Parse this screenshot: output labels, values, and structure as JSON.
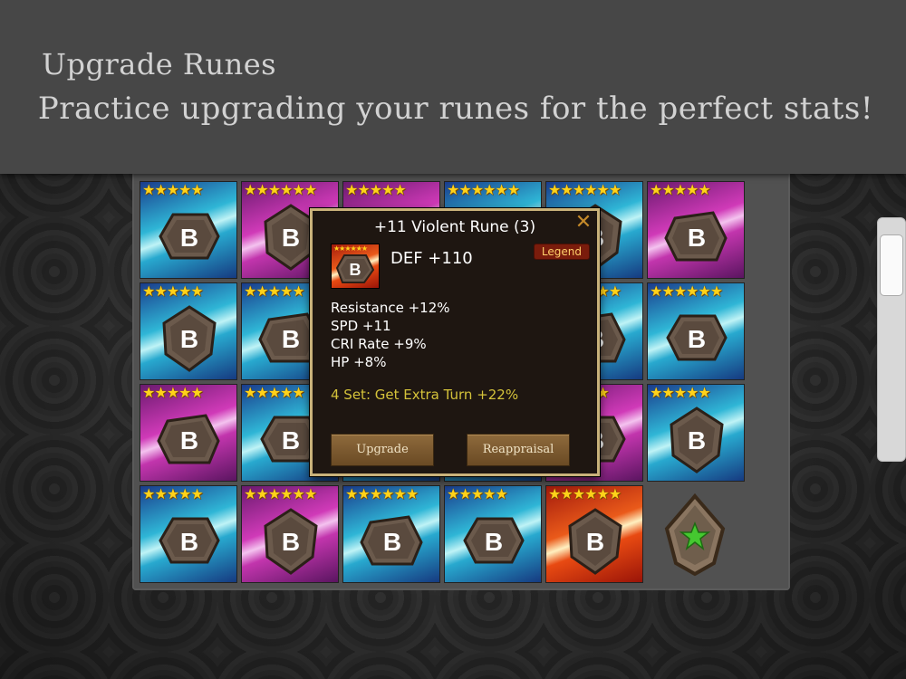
{
  "banner": {
    "title": "Upgrade Runes",
    "subtitle": "Practice upgrading your runes for the perfect stats!"
  },
  "rune_grid": {
    "rows": [
      [
        {
          "color": "blue",
          "stars": "★★★★★"
        },
        {
          "color": "pink",
          "stars": "★★★★★★"
        },
        {
          "color": "pink",
          "stars": "★★★★★"
        },
        {
          "color": "blue",
          "stars": "★★★★★★"
        },
        {
          "color": "blue",
          "stars": "★★★★★★"
        },
        {
          "color": "pink",
          "stars": "★★★★★"
        }
      ],
      [
        {
          "color": "blue",
          "stars": "★★★★★"
        },
        {
          "color": "blue",
          "stars": "★★★★★"
        },
        {
          "color": "blue",
          "stars": "★★★★★"
        },
        {
          "color": "blue",
          "stars": "★★★★★"
        },
        {
          "color": "blue",
          "stars": "★★★★★★"
        },
        {
          "color": "blue",
          "stars": "★★★★★★"
        }
      ],
      [
        {
          "color": "pink",
          "stars": "★★★★★"
        },
        {
          "color": "blue",
          "stars": "★★★★★"
        },
        {
          "color": "blue",
          "stars": "★★★★★"
        },
        {
          "color": "blue",
          "stars": "★★★★★"
        },
        {
          "color": "pink",
          "stars": "★★★★★"
        },
        {
          "color": "blue",
          "stars": "★★★★★"
        }
      ],
      [
        {
          "color": "blue",
          "stars": "★★★★★"
        },
        {
          "color": "pink",
          "stars": "★★★★★★"
        },
        {
          "color": "blue",
          "stars": "★★★★★★"
        },
        {
          "color": "blue",
          "stars": "★★★★★"
        },
        {
          "color": "red",
          "stars": "★★★★★★"
        }
      ]
    ],
    "empty_slot_icon": "star-icon"
  },
  "popup": {
    "title": "+11  Violent Rune (3)",
    "close_icon": "close-icon",
    "rune_stars": "★★★★★★",
    "main_stat": "DEF +110",
    "grade": "Legend",
    "sub_stats": [
      "Resistance +12%",
      "SPD +11",
      "CRI Rate +9%",
      "HP +8%"
    ],
    "set_bonus": "4 Set: Get Extra Turn +22%",
    "upgrade_label": "Upgrade",
    "reappraisal_label": "Reappraisal"
  },
  "colors": {
    "banner_bg": "#474747",
    "popup_border": "#c9b27a",
    "set_bonus_text": "#d4c23a",
    "grade_bg": "#7a1c0c"
  }
}
